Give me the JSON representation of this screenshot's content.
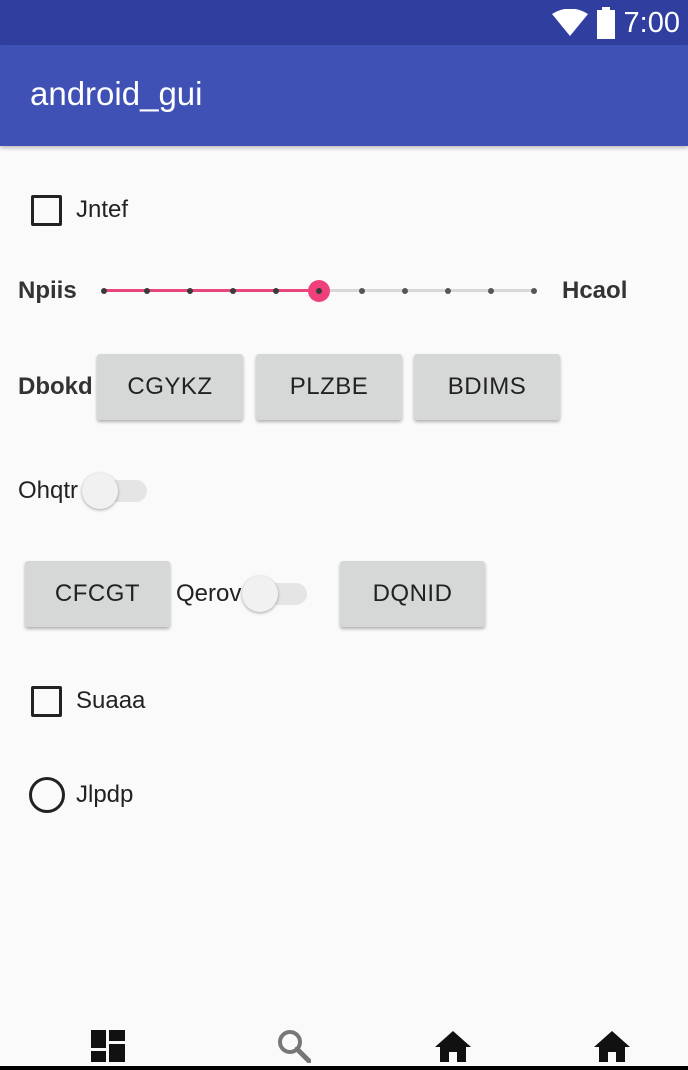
{
  "status_bar": {
    "time": "7:00",
    "color": "#303f9f"
  },
  "app_bar": {
    "title": "android_gui",
    "color": "#3f51b5"
  },
  "checkbox_1": {
    "label": "Jntef",
    "checked": false
  },
  "slider": {
    "left_label": "Npiis",
    "right_label": "Hcaol",
    "steps": 10,
    "value": 5,
    "accent": "#f0407c"
  },
  "button_row": {
    "label": "Dbokd",
    "buttons": [
      "CGYKZ",
      "PLZBE",
      "BDIMS"
    ]
  },
  "switch_1": {
    "label": "Ohqtr",
    "on": false
  },
  "mixed_row": {
    "button_left": "CFCGT",
    "switch_label": "Qerov",
    "switch_on": false,
    "button_right": "DQNID"
  },
  "checkbox_2": {
    "label": "Suaaa",
    "checked": false
  },
  "radio_1": {
    "label": "Jlpdp",
    "selected": false
  },
  "bottom_nav": {
    "items": [
      "dashboard-icon",
      "search-icon",
      "home-icon",
      "home-icon"
    ]
  }
}
